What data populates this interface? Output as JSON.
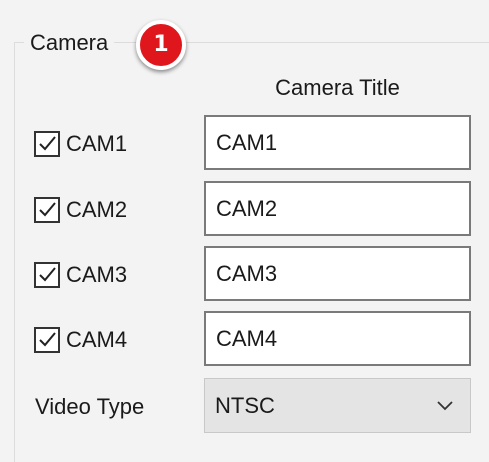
{
  "group": {
    "title": "Camera",
    "badge": "1"
  },
  "column_header": "Camera Title",
  "cameras": [
    {
      "label": "CAM1",
      "checked": true,
      "title": "CAM1"
    },
    {
      "label": "CAM2",
      "checked": true,
      "title": "CAM2"
    },
    {
      "label": "CAM3",
      "checked": true,
      "title": "CAM3"
    },
    {
      "label": "CAM4",
      "checked": true,
      "title": "CAM4"
    }
  ],
  "video_type": {
    "label": "Video Type",
    "value": "NTSC",
    "icon": "chevron-down-icon"
  },
  "colors": {
    "badge": "#e0161d",
    "background": "#f3f3f3"
  }
}
